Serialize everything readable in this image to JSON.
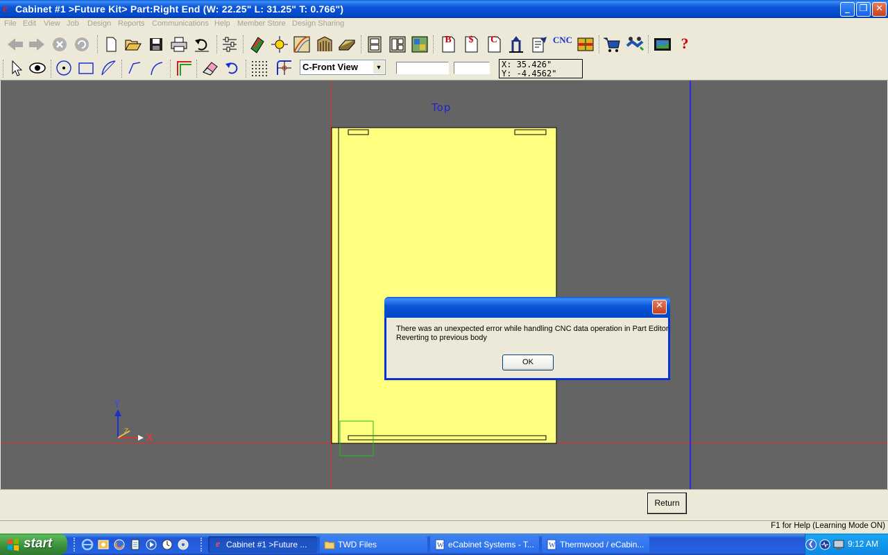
{
  "window": {
    "title": "Cabinet #1 >Future Kit> Part:Right End (W: 22.25\" L: 31.25\" T: 0.766\")",
    "app_icon": "ecabinets-e-icon"
  },
  "menu": [
    "File",
    "Edit",
    "View",
    "Job",
    "Design",
    "Reports",
    "Communications",
    "Help",
    "Member Store",
    "Design Sharing"
  ],
  "toolbar1": {
    "icons": [
      "back-icon",
      "forward-icon",
      "stop-icon",
      "refresh-icon",
      "new-icon",
      "open-icon",
      "save-icon",
      "print-icon",
      "undo-icon",
      "settings-icon",
      "material-icon",
      "lighting-icon",
      "texture-icon",
      "room-icon",
      "floor-icon",
      "cabinet-icon",
      "cabinet-list-icon",
      "layout-icon",
      "bom-icon",
      "price-icon",
      "cutlist-icon",
      "export-icon",
      "report-icon",
      "cnc-icon",
      "color-icon",
      "cart-icon",
      "handshake-icon",
      "video-icon",
      "help-icon"
    ],
    "cnc_label": "CNC",
    "bom_label": "B",
    "price_label": "$",
    "cut_label": "C",
    "help_label": "?"
  },
  "toolbar2": {
    "view_select": "C-Front View",
    "coord_x": "X: 35.426\"",
    "coord_y": "Y: -4.4562\""
  },
  "canvas": {
    "face_label": "Top",
    "axis_x": "X",
    "axis_y": "Y",
    "axis_z": "Z"
  },
  "dialog": {
    "message_line1": "There was an unexpected error while handling CNC data operation in Part Editor",
    "message_line2": "Reverting to previous body",
    "ok_label": "OK",
    "close_glyph": "✕"
  },
  "bottom": {
    "return_label": "Return",
    "status": "F1 for Help (Learning Mode ON)"
  },
  "taskbar": {
    "start_label": "start",
    "tasks": [
      {
        "label": "Cabinet #1 >Future ...",
        "icon": "ecabinets-e-icon",
        "active": true
      },
      {
        "label": "TWD Files",
        "icon": "folder-icon",
        "active": false
      },
      {
        "label": "eCabinet Systems - T...",
        "icon": "word-doc-icon",
        "active": false
      },
      {
        "label": "Thermwood / eCabin...",
        "icon": "word-doc-icon",
        "active": false
      }
    ],
    "clock": "9:12 AM"
  },
  "colors": {
    "canvas_bg": "#646464",
    "part_fill": "#ffff80",
    "guide_red": "#e03030",
    "guide_blue": "#1a1aff",
    "label_blue": "#2222cc"
  }
}
